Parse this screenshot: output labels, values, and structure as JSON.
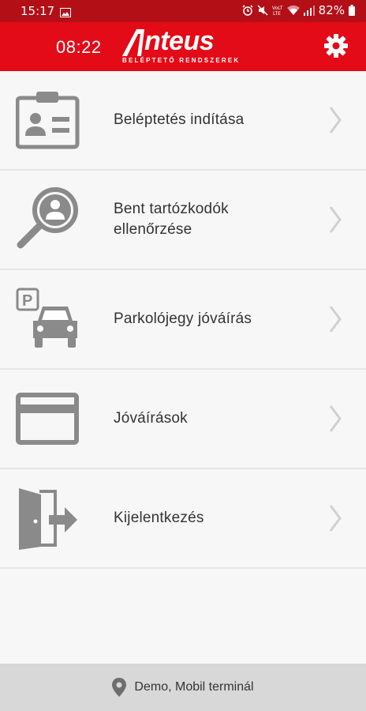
{
  "status_bar": {
    "time": "15:17",
    "battery": "82%"
  },
  "header": {
    "clock": "08:22",
    "logo_text": "Anteus",
    "logo_letter": "A",
    "logo_rest": "nteus",
    "logo_tagline": "BELÉPTETŐ RENDSZEREK"
  },
  "menu": {
    "items": [
      {
        "label": "Beléptetés indítása",
        "icon": "id-card-icon"
      },
      {
        "label": "Bent tartózkodók ellenőrzése",
        "icon": "search-person-icon"
      },
      {
        "label": "Parkolójegy jóváírás",
        "icon": "parking-car-icon"
      },
      {
        "label": "Jóváírások",
        "icon": "credit-card-icon"
      },
      {
        "label": "Kijelentkezés",
        "icon": "logout-door-icon"
      }
    ]
  },
  "footer": {
    "location": "Demo, Mobil terminál"
  },
  "colors": {
    "header": "#e30b17",
    "status_bar": "#b30f17",
    "icon": "#8a8a8a",
    "chevron": "#d0d0d0"
  }
}
